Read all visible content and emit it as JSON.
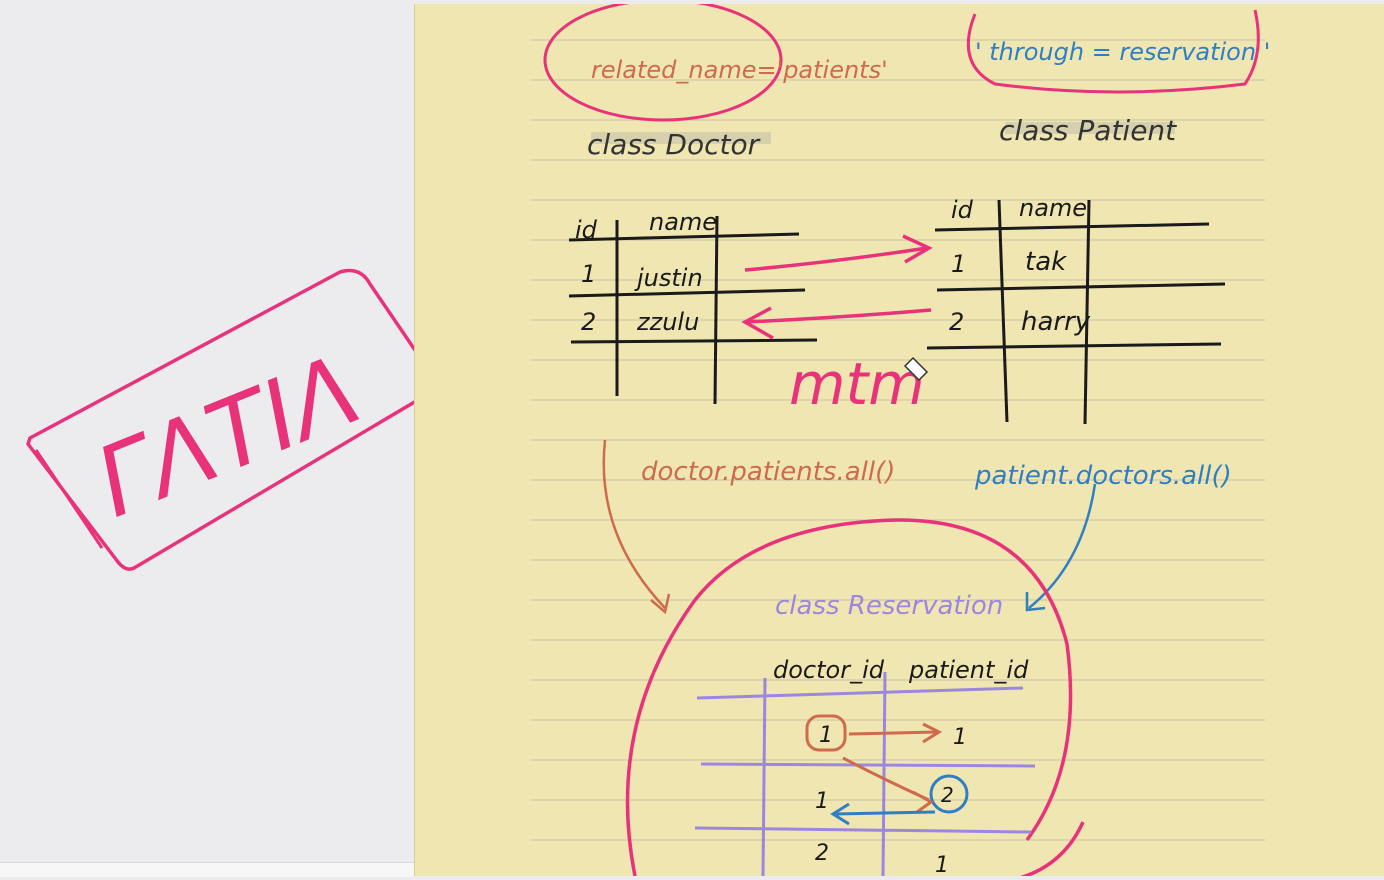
{
  "left_sticker": {
    "text": "ΓΛΤΙΛ"
  },
  "notes": {
    "related_name": "related_name='patients'",
    "through": "' through = reservation '",
    "class_doctor": "class  Doctor",
    "class_patient": "class  Patient",
    "doctor_table": {
      "headers": [
        "id",
        "name"
      ],
      "rows": [
        [
          "1",
          "justin"
        ],
        [
          "2",
          "zzulu"
        ]
      ]
    },
    "patient_table": {
      "headers": [
        "id",
        "name"
      ],
      "rows": [
        [
          "1",
          "tak"
        ],
        [
          "2",
          "harry"
        ]
      ]
    },
    "mtm": "mtm",
    "doctor_query": "doctor.patients.all()",
    "patient_query": "patient.doctors.all()",
    "class_reservation": "class  Reservation",
    "reservation_table": {
      "headers": [
        "doctor_id",
        "patient_id"
      ],
      "rows": [
        [
          "1",
          "1"
        ],
        [
          "1",
          "2"
        ],
        [
          "2",
          "1"
        ]
      ]
    }
  },
  "colors": {
    "pink": "#e8327a",
    "orange": "#cf6a4c",
    "blue": "#2f7fc3",
    "purple": "#9b87e0",
    "ink": "#1a1a1a",
    "paper": "#efe6b2",
    "rule": "#c9c3a4"
  }
}
